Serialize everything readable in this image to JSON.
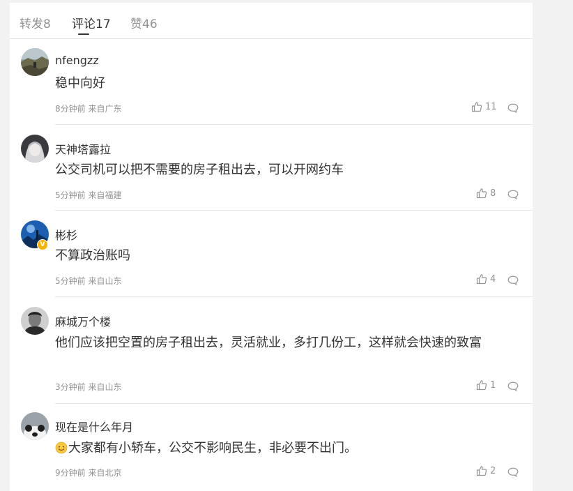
{
  "tabs": [
    {
      "label": "转发8"
    },
    {
      "label": "评论17"
    },
    {
      "label": "赞46"
    }
  ],
  "comments": [
    {
      "user": "nfengzz",
      "text": "稳中向好",
      "meta": "8分钟前 来自广东",
      "likes": "11",
      "avatar": "landscape-photo"
    },
    {
      "user": "天神塔露拉",
      "text": "公交司机可以把不需要的房子租出去，可以开网约车",
      "meta": "5分钟前 来自福建",
      "likes": "8",
      "avatar": "anime-character"
    },
    {
      "user": "彬杉",
      "text": "不算政治账吗",
      "meta": "5分钟前 来自山东",
      "likes": "4",
      "avatar": "blue-sky-photo",
      "verified": "V"
    },
    {
      "user": "麻城万个楼",
      "text": "他们应该把空置的房子租出去，灵活就业，多打几份工，这样就会快速的致富",
      "meta": "3分钟前 来自山东",
      "likes": "1",
      "avatar": "portrait-photo"
    },
    {
      "user": "现在是什么年月",
      "text": "大家都有小轿车，公交不影响民生，非必要不出门。",
      "meta": "9分钟前 来自北京",
      "likes": "2",
      "avatar": "panda-photo",
      "emoji": "smile-emoji"
    }
  ]
}
